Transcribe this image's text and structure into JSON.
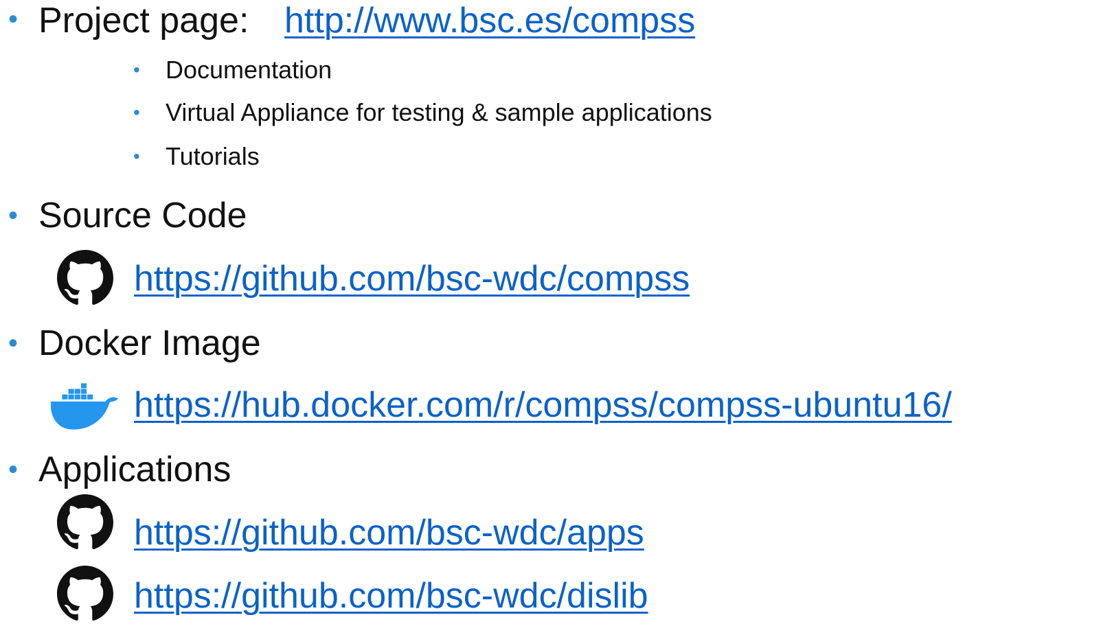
{
  "colors": {
    "bullet": "#2E8BD3",
    "link": "#0B62C8",
    "text": "#111111",
    "docker": "#2496ED"
  },
  "items": {
    "project_page": {
      "label": "Project page:",
      "link": "http://www.bsc.es/compss",
      "subitems": [
        "Documentation",
        "Virtual Appliance for testing & sample applications",
        "Tutorials"
      ]
    },
    "source_code": {
      "label": "Source Code",
      "icon": "github-icon",
      "link": "https://github.com/bsc-wdc/compss"
    },
    "docker_image": {
      "label": "Docker Image",
      "icon": "docker-icon",
      "link": "https://hub.docker.com/r/compss/compss-ubuntu16/"
    },
    "applications": {
      "label": "Applications",
      "links": [
        {
          "icon": "github-icon",
          "url": "https://github.com/bsc-wdc/apps"
        },
        {
          "icon": "github-icon",
          "url": "https://github.com/bsc-wdc/dislib"
        }
      ]
    }
  },
  "bullet_char": "•"
}
